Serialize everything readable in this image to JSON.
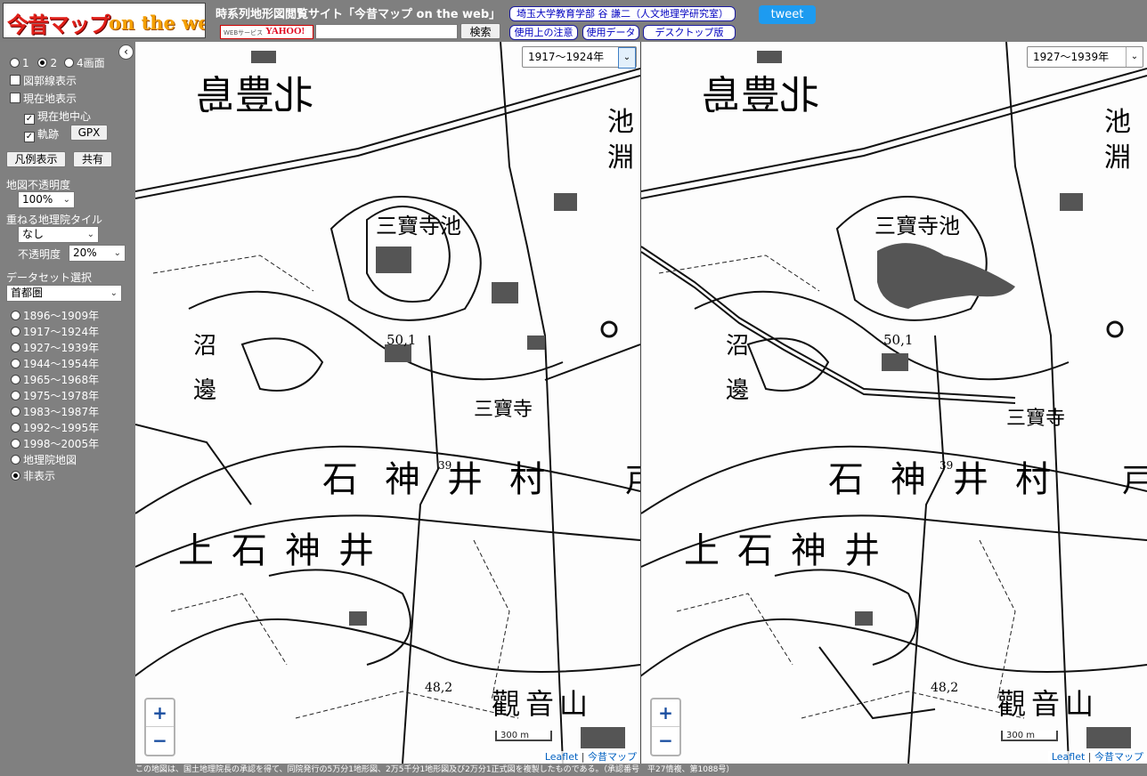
{
  "header": {
    "logo": {
      "jp": "今昔マップ",
      "en": "on the web"
    },
    "site_title": "時系列地形図閲覧サイト「今昔マップ on the web」",
    "yahoo": {
      "services": "WEBサービス",
      "brand": "YAHOO!"
    },
    "search": {
      "value": "",
      "button": "検索"
    },
    "links": {
      "author": "埼玉大学教育学部 谷 謙二（人文地理学研究室）",
      "notes": "使用上の注意",
      "data": "使用データ",
      "desktop": "デスクトップ版"
    },
    "tweet": "tweet"
  },
  "sidebar": {
    "screen_modes": [
      "1",
      "2",
      "4画面"
    ],
    "screen_mode_selected": "2",
    "grid_lines": "図郭線表示",
    "current_location": "現在地表示",
    "center_on_location": "現在地中心",
    "track": "軌跡",
    "gpx_button": "GPX",
    "legend_button": "凡例表示",
    "share_button": "共有",
    "map_opacity_label": "地図不透明度",
    "map_opacity_value": "100%",
    "overlay_label": "重ねる地理院タイル",
    "overlay_value": "なし",
    "overlay_opacity_label": "不透明度",
    "overlay_opacity_value": "20%",
    "dataset_label": "データセット選択",
    "dataset_value": "首都圏",
    "periods": [
      "1896〜1909年",
      "1917〜1924年",
      "1927〜1939年",
      "1944〜1954年",
      "1965〜1968年",
      "1975〜1978年",
      "1983〜1987年",
      "1992〜1995年",
      "1998〜2005年",
      "地理院地図",
      "非表示"
    ],
    "period_selected": "非表示"
  },
  "maps": {
    "left": {
      "period": "1917〜1924年"
    },
    "right": {
      "period": "1927〜1939年"
    },
    "zoom_in": "+",
    "zoom_out": "−",
    "scale": "300 m",
    "attribution_leaflet": "Leaflet",
    "attribution_sep": "|",
    "attribution_konjaku": "今昔マップ"
  },
  "map_labels": {
    "kitatoshima": "北豊島",
    "ike": "池",
    "fuchi": "淵",
    "sanpoji_pond": "三寶寺池",
    "num501": "50,1",
    "shakujii_village": "石神井村",
    "kamishakujii": "上石神井",
    "kannonyama": "觀音山",
    "numa": "沼",
    "be": "邊",
    "to": "戸",
    "sanpoji": "三寶寺",
    "num482": "48,2",
    "num39": "39"
  },
  "footer": "この地図は、国土地理院長の承認を得て、同院発行の5万分1地形図、2万5千分1地形図及び2万分1正式図を複製したものである。（承認番号　平27情複、第1088号）"
}
